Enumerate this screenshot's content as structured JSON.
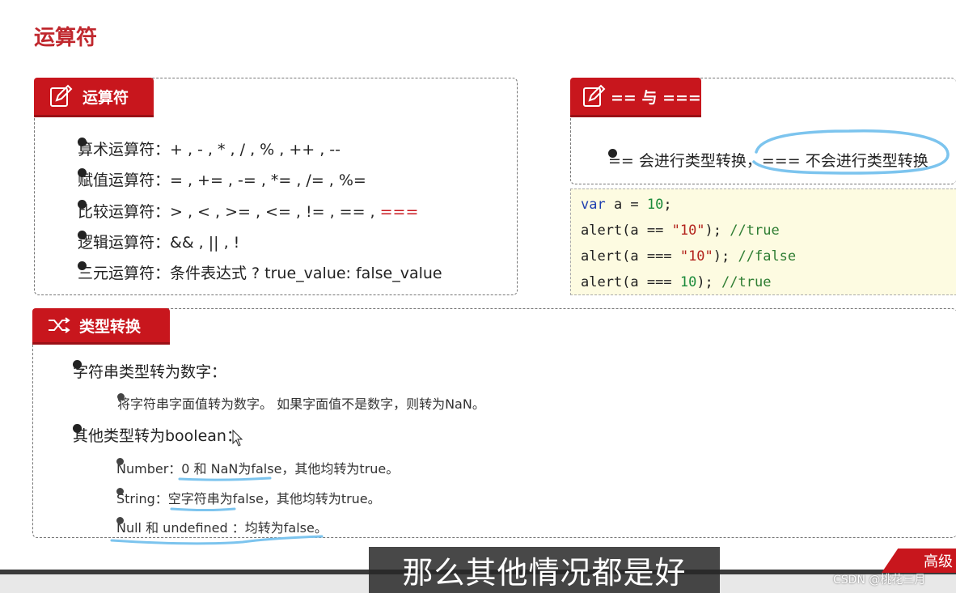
{
  "page_title": "运算符",
  "operators": {
    "tab_label": "运算符",
    "items": [
      {
        "text": "算术运算符：+ , - , * , / , % , ++ , --"
      },
      {
        "text": "赋值运算符：= , += , -= , *= , /= , %="
      },
      {
        "text": "比较运算符：> , < , >= , <= , != , == , ",
        "highlight": "==="
      },
      {
        "text": "逻辑运算符：&& , || , !"
      },
      {
        "text": "三元运算符：条件表达式 ? true_value: false_value"
      }
    ]
  },
  "equality": {
    "tab_label": "== 与 ===",
    "note_part1": "== 会进行类型转换，",
    "note_part2": "=== 不会进行类型转换"
  },
  "code": {
    "line1": {
      "kw": "var",
      "rest": " a = ",
      "num": "10",
      "end": ";"
    },
    "line2": {
      "pre": "alert(a == ",
      "str": "\"10\"",
      "post": "); ",
      "cmt": "//true"
    },
    "line3": {
      "pre": "alert(a === ",
      "str": "\"10\"",
      "post": "); ",
      "cmt": "//false"
    },
    "line4": {
      "pre": "alert(a === ",
      "num": "10",
      "post": "); ",
      "cmt": "//true"
    }
  },
  "type_conversion": {
    "tab_label": "类型转换",
    "item1": "字符串类型转为数字：",
    "item1_sub": "将字符串字面值转为数字。 如果字面值不是数字，则转为NaN。",
    "item2": "其他类型转为boolean：",
    "item2_subs": [
      "Number：0 和 NaN为false，其他均转为true。",
      "String：空字符串为false，其他均转为true。",
      "Null 和 undefined ：均转为false。"
    ]
  },
  "subtitle": "那么其他情况都是好",
  "watermark": "CSDN @桃花三月",
  "corner_badge": "高级",
  "colors": {
    "accent": "#c8161d",
    "annotation": "#7cc4ee"
  }
}
